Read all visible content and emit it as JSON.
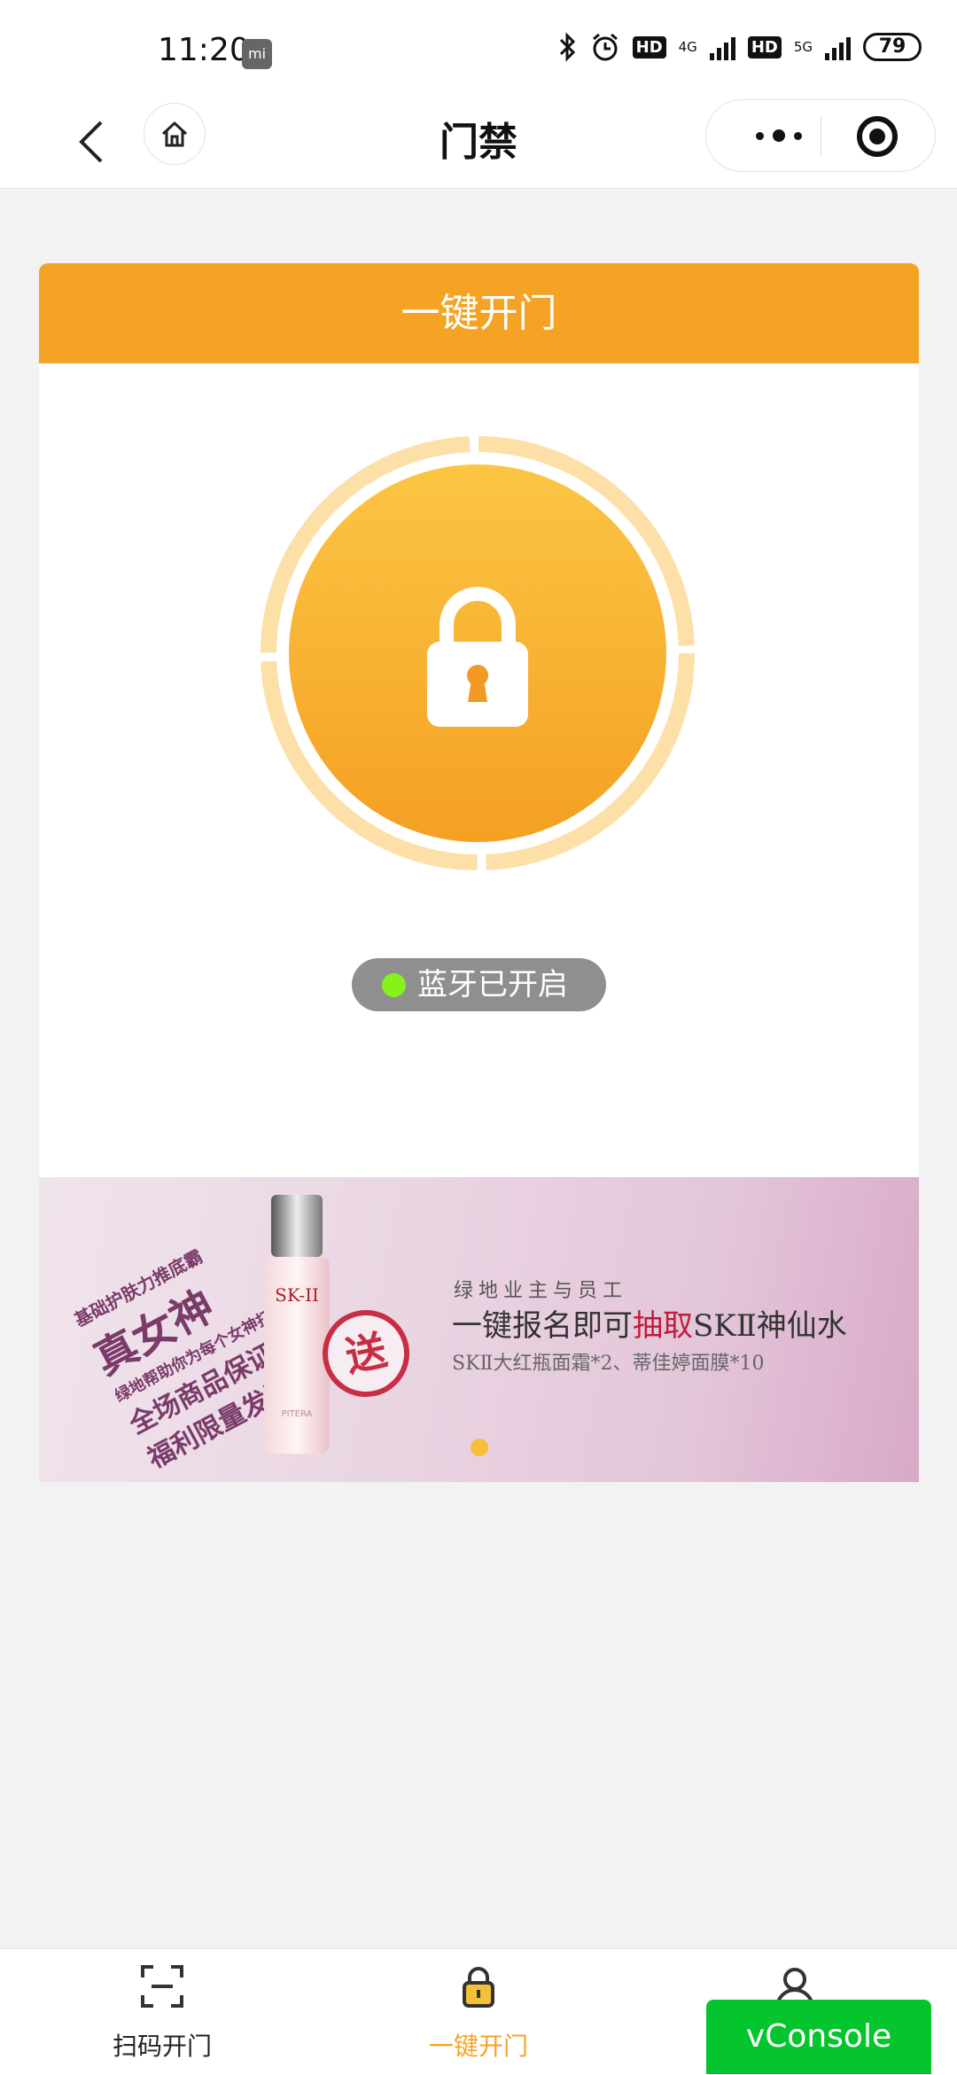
{
  "status_bar": {
    "time": "11:20",
    "mi_icon": "mi-notification-icon",
    "hd_badge_1": "HD",
    "network_1": "4G",
    "hd_badge_2": "HD",
    "network_2": "5G",
    "battery": "79"
  },
  "nav": {
    "title": "门禁",
    "back_icon": "chevron-left-icon",
    "home_icon": "home-icon",
    "more_icon": "more-dots-icon",
    "close_icon": "target-circle-icon"
  },
  "card": {
    "header": "一键开门",
    "lock_icon": "padlock-icon",
    "bluetooth_status": "蓝牙已开启",
    "status_color": "#86f21a",
    "accent": "#f4a325"
  },
  "banner": {
    "slogan_1": "基础护肤力推底霸",
    "slogan_2": "真女神",
    "slogan_3": "绿地帮助你为每个女神打造",
    "slogan_4": "全场商品保证正品",
    "slogan_5": "福利限量发送",
    "bottle_brand": "SK-II",
    "bottle_sub": "PITERA",
    "stamp": "送",
    "line1": "绿地业主与员工",
    "line2_pre": "一键报名即可",
    "line2_highlight": "抽取",
    "line2_post": "SKⅡ神仙水",
    "line3": "SKⅡ大红瓶面霜*2、蒂佳婷面膜*10",
    "dot_color": "#f4c038"
  },
  "tabs": [
    {
      "label": "扫码开门",
      "icon": "scan-icon",
      "active": false
    },
    {
      "label": "一键开门",
      "icon": "padlock-icon",
      "active": true
    },
    {
      "label": "",
      "icon": "user-icon",
      "active": false
    }
  ],
  "vconsole": "vConsole"
}
